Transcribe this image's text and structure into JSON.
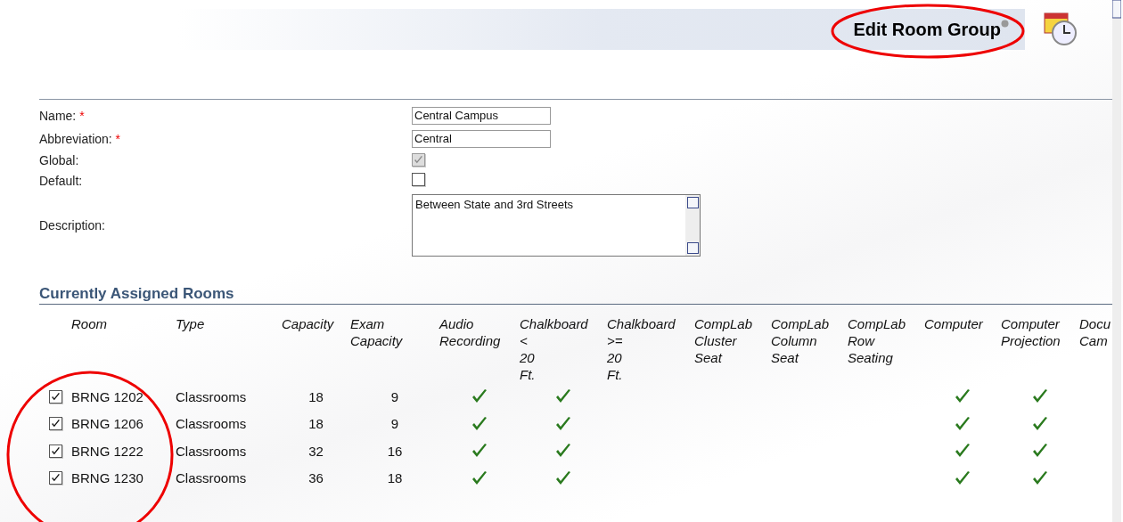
{
  "header": {
    "title": "Edit Room Group"
  },
  "form": {
    "fields": [
      {
        "kind": "text",
        "label": "Name:",
        "marker": "*",
        "value": "Central Campus"
      },
      {
        "kind": "text",
        "label": "Abbreviation:",
        "marker": "*",
        "value": "Central"
      },
      {
        "kind": "checkbox",
        "label": "Global:",
        "checked": true,
        "disabled": true
      },
      {
        "kind": "checkbox",
        "label": "Default:",
        "checked": false,
        "disabled": false
      },
      {
        "kind": "textarea",
        "label": "Description:",
        "value": "Between State and 3rd Streets"
      }
    ]
  },
  "section": {
    "title": "Currently Assigned Rooms"
  },
  "table": {
    "columns": [
      {
        "kind": "check"
      },
      {
        "kind": "text",
        "lines": [
          "Room"
        ]
      },
      {
        "kind": "text",
        "lines": [
          "Type"
        ]
      },
      {
        "kind": "number",
        "lines": [
          "Capacity"
        ]
      },
      {
        "kind": "number",
        "lines": [
          "Exam",
          "Capacity"
        ]
      },
      {
        "kind": "feature",
        "lines": [
          "Audio",
          "Recording"
        ]
      },
      {
        "kind": "feature",
        "lines": [
          "Chalkboard",
          "<",
          "20",
          "Ft."
        ]
      },
      {
        "kind": "feature",
        "lines": [
          "Chalkboard",
          ">=",
          "20",
          "Ft."
        ]
      },
      {
        "kind": "feature",
        "lines": [
          "CompLab",
          "Cluster",
          "Seat"
        ]
      },
      {
        "kind": "feature",
        "lines": [
          "CompLab",
          "Column",
          "Seat"
        ]
      },
      {
        "kind": "feature",
        "lines": [
          "CompLab",
          "Row",
          "Seating"
        ]
      },
      {
        "kind": "feature",
        "lines": [
          "Computer"
        ]
      },
      {
        "kind": "feature",
        "lines": [
          "Computer",
          "Projection"
        ]
      },
      {
        "kind": "feature",
        "lines": [
          "Docu",
          "Cam"
        ]
      }
    ],
    "rows": [
      {
        "checked": true,
        "room": "BRNG 1202",
        "type": "Classrooms",
        "capacity": "18",
        "exam_capacity": "9",
        "features": [
          true,
          true,
          false,
          false,
          false,
          false,
          true,
          true,
          false
        ]
      },
      {
        "checked": true,
        "room": "BRNG 1206",
        "type": "Classrooms",
        "capacity": "18",
        "exam_capacity": "9",
        "features": [
          true,
          true,
          false,
          false,
          false,
          false,
          true,
          true,
          false
        ]
      },
      {
        "checked": true,
        "room": "BRNG 1222",
        "type": "Classrooms",
        "capacity": "32",
        "exam_capacity": "16",
        "features": [
          true,
          true,
          false,
          false,
          false,
          false,
          true,
          true,
          false
        ]
      },
      {
        "checked": true,
        "room": "BRNG 1230",
        "type": "Classrooms",
        "capacity": "36",
        "exam_capacity": "18",
        "features": [
          true,
          true,
          false,
          false,
          false,
          false,
          true,
          true,
          false
        ]
      }
    ]
  }
}
